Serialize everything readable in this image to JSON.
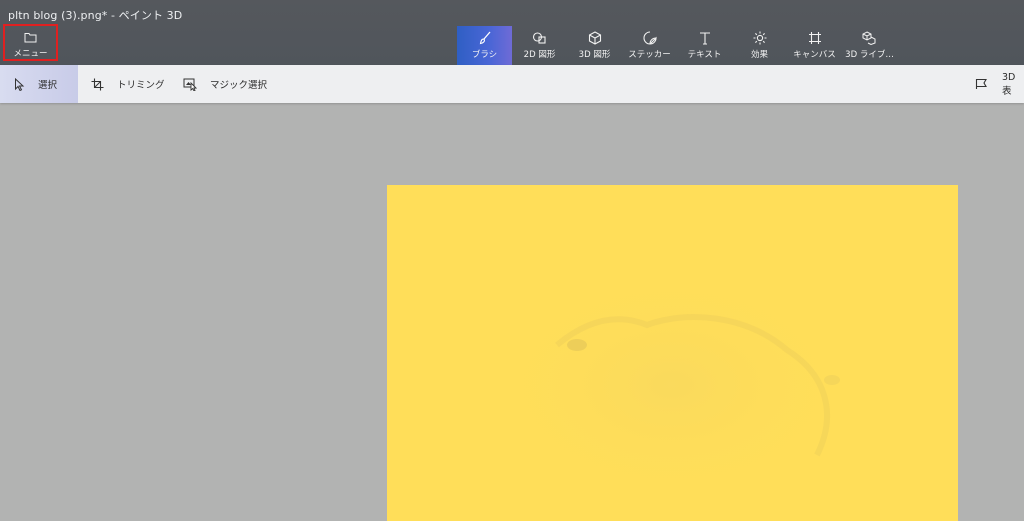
{
  "window": {
    "title": "pltn blog (3).png* - ペイント 3D"
  },
  "menu": {
    "label": "メニュー",
    "icon": "folder-icon"
  },
  "tools": [
    {
      "label": "ブラシ",
      "icon": "brush-icon",
      "active": true
    },
    {
      "label": "2D 図形",
      "icon": "shapes-2d-icon"
    },
    {
      "label": "3D 図形",
      "icon": "cube-icon"
    },
    {
      "label": "ステッカー",
      "icon": "sticker-icon"
    },
    {
      "label": "テキスト",
      "icon": "text-icon"
    },
    {
      "label": "効果",
      "icon": "sun-icon"
    },
    {
      "label": "キャンバス",
      "icon": "canvas-crop-icon"
    },
    {
      "label": "3D ライブ…",
      "icon": "library-3d-icon"
    }
  ],
  "subtoolbar": {
    "select": {
      "label": "選択",
      "icon": "cursor-icon"
    },
    "trim": {
      "label": "トリミング",
      "icon": "crop-icon"
    },
    "magic_select": {
      "label": "マジック選択",
      "icon": "magic-select-icon"
    },
    "view3d": {
      "label": "3D 表",
      "icon": "view-3d-icon"
    }
  },
  "colors": {
    "titlebar": "#53575c",
    "workspace": "#b2b3b2",
    "canvas": "#ffde59",
    "active_tool": "#3f63d0",
    "highlight_box": "#e02020"
  }
}
